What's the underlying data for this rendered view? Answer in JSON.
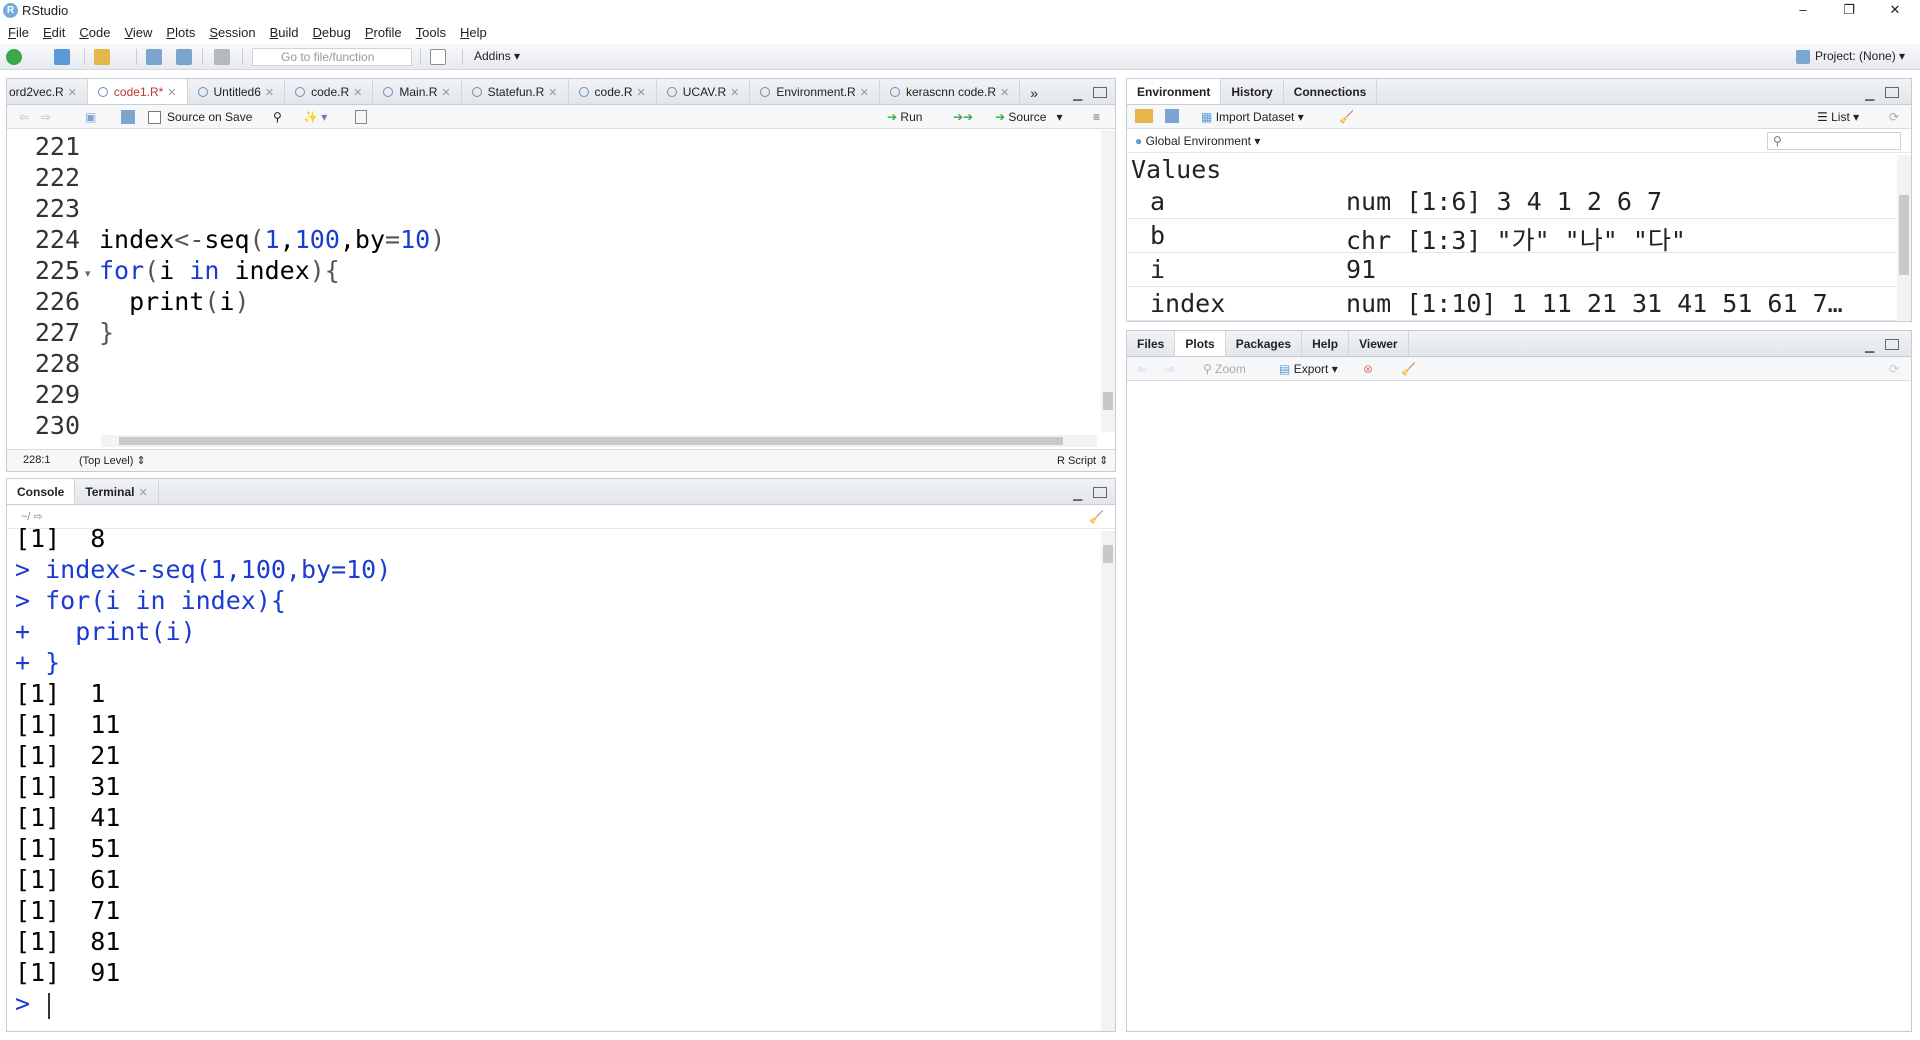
{
  "window": {
    "title": "RStudio",
    "minimize": "–",
    "restore": "❐",
    "close": "✕"
  },
  "menu": [
    "File",
    "Edit",
    "Code",
    "View",
    "Plots",
    "Session",
    "Build",
    "Debug",
    "Profile",
    "Tools",
    "Help"
  ],
  "toolbar": {
    "goto_placeholder": "Go to file/function",
    "addins": "Addins",
    "project": "Project: (None)"
  },
  "editor": {
    "tabs": [
      {
        "label": "ord2vec.R",
        "active": false
      },
      {
        "label": "code1.R*",
        "active": true
      },
      {
        "label": "Untitled6",
        "active": false
      },
      {
        "label": "code.R",
        "active": false
      },
      {
        "label": "Main.R",
        "active": false
      },
      {
        "label": "Statefun.R",
        "active": false
      },
      {
        "label": "code.R",
        "active": false
      },
      {
        "label": "UCAV.R",
        "active": false
      },
      {
        "label": "Environment.R",
        "active": false
      },
      {
        "label": "kerascnn code.R",
        "active": false
      }
    ],
    "source_on_save": "Source on Save",
    "run": "Run",
    "source": "Source",
    "line_numbers": [
      "221",
      "222",
      "223",
      "224",
      "225",
      "226",
      "227",
      "228",
      "229",
      "230"
    ],
    "status_pos": "228:1",
    "status_scope": "(Top Level)",
    "status_type": "R Script"
  },
  "console": {
    "tabs": [
      "Console",
      "Terminal"
    ],
    "path": "~/",
    "lines": [
      {
        "text": "[1]  8",
        "input": false
      },
      {
        "text": "> index<-seq(1,100,by=10)",
        "input": true
      },
      {
        "text": "> for(i in index){",
        "input": true
      },
      {
        "text": "+   print(i)",
        "input": true
      },
      {
        "text": "+ }",
        "input": true
      },
      {
        "text": "[1]  1",
        "input": false
      },
      {
        "text": "[1]  11",
        "input": false
      },
      {
        "text": "[1]  21",
        "input": false
      },
      {
        "text": "[1]  31",
        "input": false
      },
      {
        "text": "[1]  41",
        "input": false
      },
      {
        "text": "[1]  51",
        "input": false
      },
      {
        "text": "[1]  61",
        "input": false
      },
      {
        "text": "[1]  71",
        "input": false
      },
      {
        "text": "[1]  81",
        "input": false
      },
      {
        "text": "[1]  91",
        "input": false
      },
      {
        "text": "> ",
        "input": true
      }
    ]
  },
  "environment": {
    "tabs": [
      "Environment",
      "History",
      "Connections"
    ],
    "import": "Import Dataset",
    "list": "List",
    "scope": "Global Environment",
    "section": "Values",
    "rows": [
      {
        "name": "a",
        "value": "num [1:6] 3 4 1 2 6 7"
      },
      {
        "name": "b",
        "value": "chr [1:3] \"가\" \"나\" \"다\""
      },
      {
        "name": "i",
        "value": "91"
      },
      {
        "name": "index",
        "value": "num [1:10] 1 11 21 31 41 51 61 7…"
      }
    ]
  },
  "files": {
    "tabs": [
      "Files",
      "Plots",
      "Packages",
      "Help",
      "Viewer"
    ],
    "zoom": "Zoom",
    "export": "Export"
  }
}
